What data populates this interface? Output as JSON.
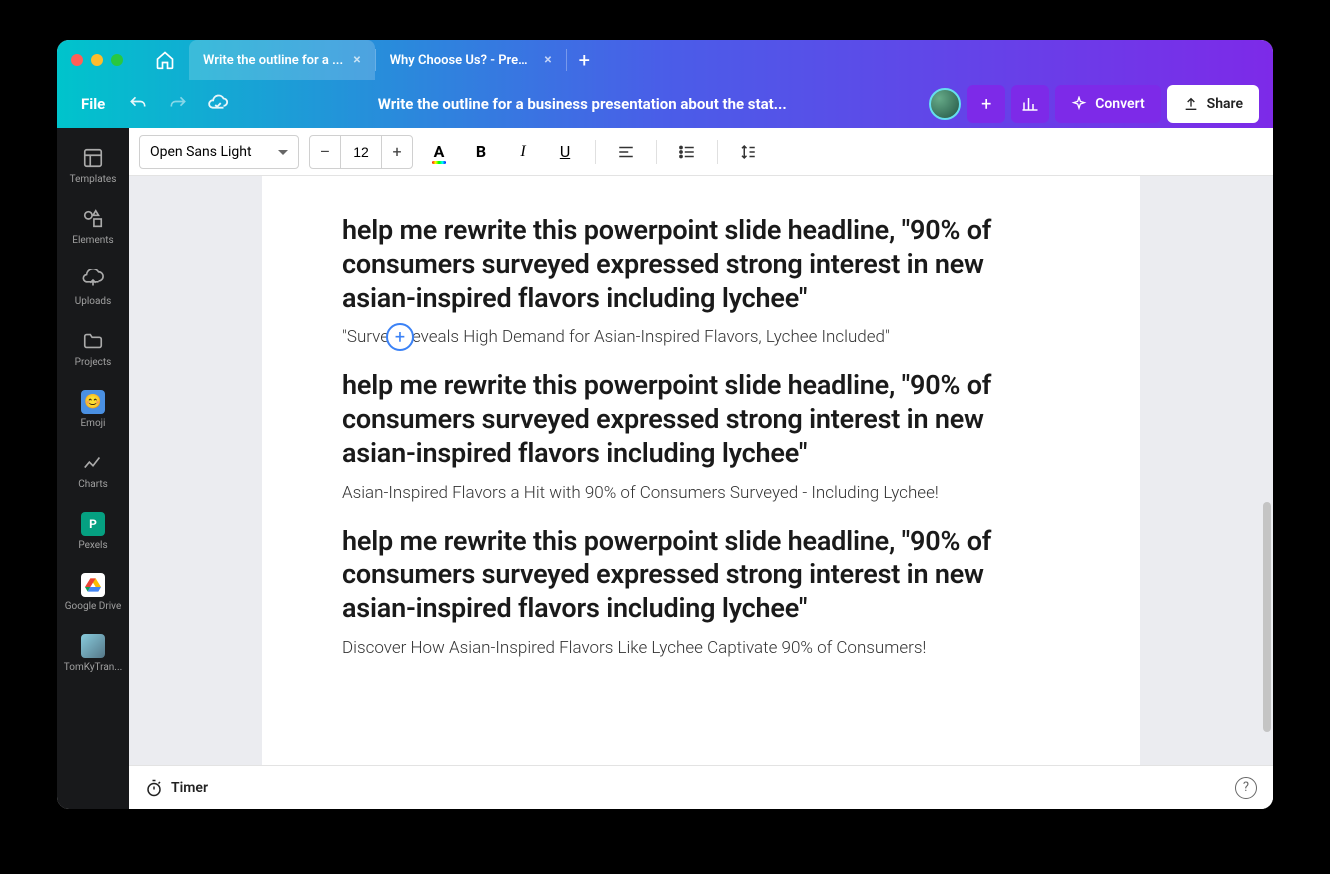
{
  "tabs": [
    {
      "label": "Write the outline for a ...",
      "active": true
    },
    {
      "label": "Why Choose Us? - Pres...",
      "active": false
    }
  ],
  "toolbar": {
    "file": "File",
    "doc_title": "Write the outline for a business presentation about the stat...",
    "convert": "Convert",
    "share": "Share"
  },
  "format": {
    "font": "Open Sans Light",
    "size": "12"
  },
  "sidebar": {
    "items": [
      {
        "label": "Templates"
      },
      {
        "label": "Elements"
      },
      {
        "label": "Uploads"
      },
      {
        "label": "Projects"
      },
      {
        "label": "Emoji"
      },
      {
        "label": "Charts"
      },
      {
        "label": "Pexels"
      },
      {
        "label": "Google Drive"
      },
      {
        "label": "TomKyTran..."
      }
    ]
  },
  "document": {
    "blocks": [
      {
        "type": "heading",
        "text": "help me rewrite this powerpoint slide headline, \"90% of consumers surveyed expressed strong interest in new asian-inspired flavors including lychee\""
      },
      {
        "type": "body",
        "text": "\"Survey Reveals High Demand for Asian-Inspired Flavors, Lychee Included\"",
        "add_button": true
      },
      {
        "type": "heading",
        "text": "help me rewrite this powerpoint slide headline, \"90% of consumers surveyed expressed strong interest in new asian-inspired flavors including lychee\""
      },
      {
        "type": "body",
        "text": "Asian-Inspired Flavors a Hit with 90% of Consumers Surveyed - Including Lychee!"
      },
      {
        "type": "heading",
        "text": "help me rewrite this powerpoint slide headline, \"90% of consumers surveyed expressed strong interest in new asian-inspired flavors including lychee\""
      },
      {
        "type": "body",
        "text": "Discover How Asian-Inspired Flavors Like Lychee Captivate 90% of Consumers!"
      }
    ]
  },
  "footer": {
    "timer": "Timer"
  }
}
